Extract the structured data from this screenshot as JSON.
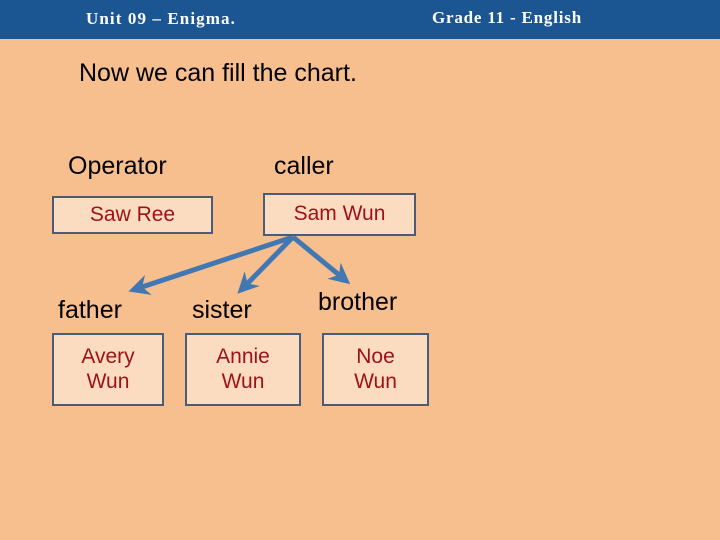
{
  "header": {
    "title": "Unit  09  –  Enigma.",
    "subject": "Grade  11 - English",
    "bar_color": "#1B5693",
    "text_color": "#FFFFFF"
  },
  "slide": {
    "background_color": "#F7BE8E",
    "heading": "Now we can fill the chart."
  },
  "chart": {
    "box_fill": "#FBDCC0",
    "box_border": "#4C5C77",
    "name_color": "#9E1116",
    "label_color": "#000000",
    "arrow_color": "#4178B4",
    "top_row": [
      {
        "role": "Operator",
        "name": "Saw Ree"
      },
      {
        "role": "caller",
        "name": "Sam Wun"
      }
    ],
    "bottom_row": [
      {
        "role": "father",
        "name": "Avery\nWun"
      },
      {
        "role": "sister",
        "name": "Annie\nWun"
      },
      {
        "role": "brother",
        "name": "Noe\nWun"
      }
    ],
    "arrows": [
      {
        "from": "caller",
        "to": "father"
      },
      {
        "from": "caller",
        "to": "sister"
      },
      {
        "from": "caller",
        "to": "brother"
      }
    ]
  }
}
